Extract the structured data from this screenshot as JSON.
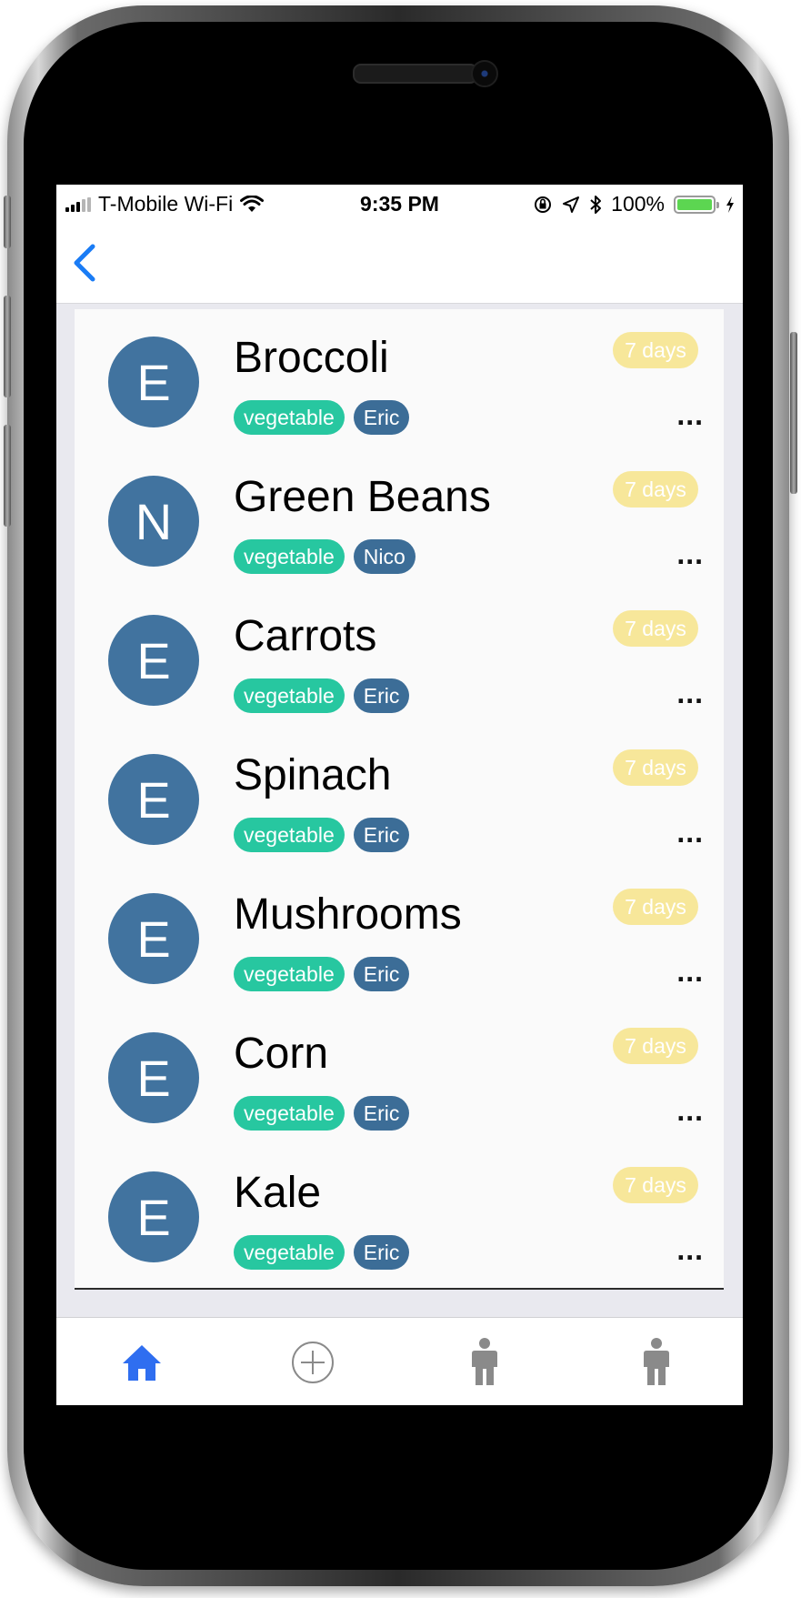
{
  "status_bar": {
    "carrier": "T-Mobile Wi-Fi",
    "time": "9:35 PM",
    "battery": "100%",
    "icons": [
      "signal-icon",
      "wifi-icon",
      "orientation-lock-icon",
      "location-icon",
      "bluetooth-icon",
      "battery-icon",
      "charging-icon"
    ]
  },
  "nav": {
    "back_icon": "chevron-left-icon"
  },
  "items": [
    {
      "avatar": "E",
      "name": "Broccoli",
      "category": "vegetable",
      "person": "Eric",
      "days": "7 days",
      "more": "..."
    },
    {
      "avatar": "N",
      "name": "Green Beans",
      "category": "vegetable",
      "person": "Nico",
      "days": "7 days",
      "more": "..."
    },
    {
      "avatar": "E",
      "name": "Carrots",
      "category": "vegetable",
      "person": "Eric",
      "days": "7 days",
      "more": "..."
    },
    {
      "avatar": "E",
      "name": "Spinach",
      "category": "vegetable",
      "person": "Eric",
      "days": "7 days",
      "more": "..."
    },
    {
      "avatar": "E",
      "name": "Mushrooms",
      "category": "vegetable",
      "person": "Eric",
      "days": "7 days",
      "more": "..."
    },
    {
      "avatar": "E",
      "name": "Corn",
      "category": "vegetable",
      "person": "Eric",
      "days": "7 days",
      "more": "..."
    },
    {
      "avatar": "E",
      "name": "Kale",
      "category": "vegetable",
      "person": "Eric",
      "days": "7 days",
      "more": "..."
    }
  ],
  "tab_bar": {
    "tabs": [
      {
        "icon": "home-icon",
        "active": true
      },
      {
        "icon": "add-circle-icon",
        "active": false
      },
      {
        "icon": "person-icon",
        "active": false
      },
      {
        "icon": "person-icon",
        "active": false
      }
    ]
  },
  "colors": {
    "avatar": "#41739f",
    "category_tag": "#27c7a0",
    "person_tag": "#3c6d97",
    "days_badge": "#f7e79a",
    "active_tab": "#2f6ef0",
    "inactive_tab": "#8a8a8a",
    "back_chevron": "#1a7cf5"
  }
}
